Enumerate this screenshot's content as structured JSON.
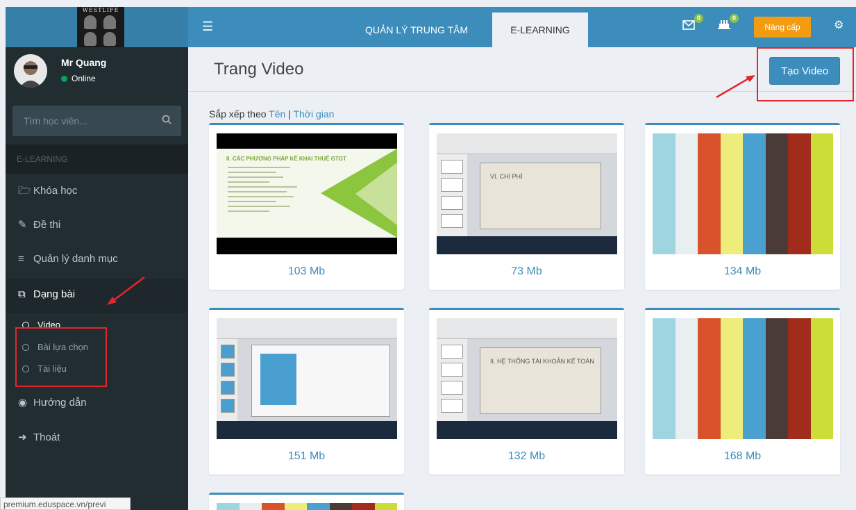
{
  "header": {
    "logo_text": "WESTLIFE",
    "tabs": [
      {
        "label": "QUẢN LÝ TRUNG TÂM",
        "active": false
      },
      {
        "label": "E-LEARNING",
        "active": true
      }
    ],
    "mail_badge": "0",
    "bell_badge": "0",
    "upgrade_label": "Nâng cấp",
    "accent_color": "#3c8dbc",
    "upgrade_color": "#f39c12"
  },
  "sidebar": {
    "user_name": "Mr Quang",
    "user_status": "Online",
    "search_placeholder": "Tìm học viên...",
    "section_label": "E-LEARNING",
    "menu": [
      {
        "label": "Khóa học",
        "icon": "folder-open-icon"
      },
      {
        "label": "Đề thi",
        "icon": "edit-icon"
      },
      {
        "label": "Quản lý danh mục",
        "icon": "list-icon"
      },
      {
        "label": "Dạng bài",
        "icon": "clone-icon"
      },
      {
        "label": "Hướng dẫn",
        "icon": "life-ring-icon"
      },
      {
        "label": "Thoát",
        "icon": "sign-out-icon"
      }
    ],
    "submenu": [
      {
        "label": "Video",
        "active": true
      },
      {
        "label": "Bài lựa chọn",
        "active": false
      },
      {
        "label": "Tài liệu",
        "active": false
      }
    ]
  },
  "main": {
    "page_title": "Trang Video",
    "create_button": "Tạo Video",
    "sort_prefix": "Sắp xếp theo",
    "sort_by_name": "Tên",
    "sort_separator": "|",
    "sort_by_time": "Thời gian",
    "videos": [
      {
        "size": "103 Mb",
        "thumb": "slide-green",
        "slide_title": "II. CÁC PHƯƠNG PHÁP KÊ KHAI THUẾ GTGT"
      },
      {
        "size": "73 Mb",
        "thumb": "ppt",
        "slide_title": "VI. CHI PHÍ"
      },
      {
        "size": "134 Mb",
        "thumb": "color-bars"
      },
      {
        "size": "151 Mb",
        "thumb": "ppt-blue"
      },
      {
        "size": "132 Mb",
        "thumb": "ppt",
        "slide_title": "II. HỆ THỐNG TÀI KHOẢN KẾ TOÁN"
      },
      {
        "size": "168 Mb",
        "thumb": "color-bars"
      },
      {
        "size": "",
        "thumb": "color-bars"
      }
    ]
  },
  "status_url": "premium.eduspace.vn/previ"
}
